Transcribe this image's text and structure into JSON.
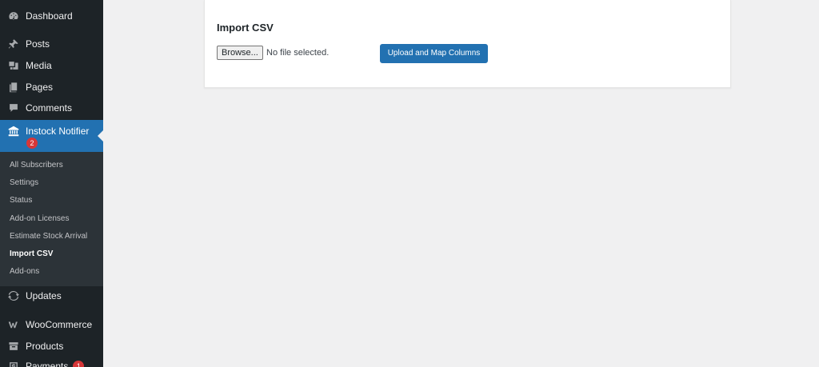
{
  "sidebar": {
    "items": [
      {
        "label": "Dashboard",
        "icon": "dashboard-icon"
      },
      {
        "label": "Posts",
        "icon": "pin-icon"
      },
      {
        "label": "Media",
        "icon": "media-icon"
      },
      {
        "label": "Pages",
        "icon": "pages-icon"
      },
      {
        "label": "Comments",
        "icon": "comment-icon"
      },
      {
        "label": "Instock Notifier",
        "icon": "notifier-icon",
        "badge": "2",
        "active": true
      },
      {
        "label": "Updates",
        "icon": "updates-icon"
      },
      {
        "label": "WooCommerce",
        "icon": "woocommerce-icon"
      },
      {
        "label": "Products",
        "icon": "archive-icon"
      },
      {
        "label": "Payments",
        "icon": "payments-icon",
        "badge": "1"
      }
    ],
    "submenu": [
      {
        "label": "All Subscribers"
      },
      {
        "label": "Settings"
      },
      {
        "label": "Status"
      },
      {
        "label": "Add-on Licenses"
      },
      {
        "label": "Estimate Stock Arrival"
      },
      {
        "label": "Import CSV",
        "current": true
      },
      {
        "label": "Add-ons"
      }
    ]
  },
  "main": {
    "title": "Import CSV",
    "browse_label": "Browse...",
    "file_status": "No file selected.",
    "upload_label": "Upload and Map Columns"
  },
  "colors": {
    "sidebar_bg": "#1d2327",
    "submenu_bg": "#2c3338",
    "accent": "#2271b1",
    "badge": "#d63638"
  }
}
